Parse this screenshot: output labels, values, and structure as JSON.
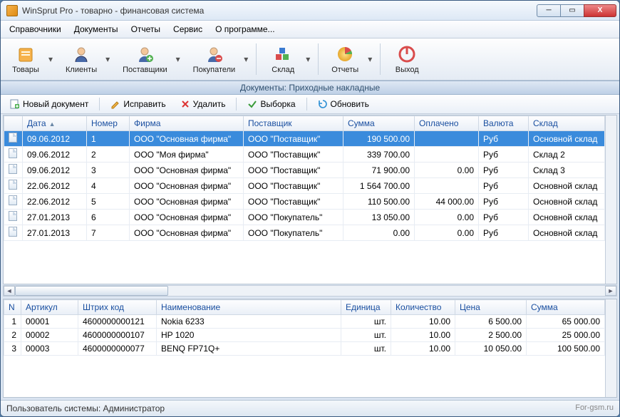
{
  "window": {
    "title": "WinSprut Pro - товарно - финансовая система"
  },
  "menu": [
    "Справочники",
    "Документы",
    "Отчеты",
    "Сервис",
    "О программе..."
  ],
  "toolbar": [
    {
      "label": "Товары",
      "icon": "goods"
    },
    {
      "label": "Клиенты",
      "icon": "clients"
    },
    {
      "label": "Поставщики",
      "icon": "suppliers"
    },
    {
      "label": "Покупатели",
      "icon": "buyers"
    },
    {
      "label": "Склад",
      "icon": "warehouse"
    },
    {
      "label": "Отчеты",
      "icon": "reports"
    },
    {
      "label": "Выход",
      "icon": "exit"
    }
  ],
  "panel_title": "Документы: Приходные накладные",
  "actions": {
    "new": "Новый документ",
    "edit": "Исправить",
    "delete": "Удалить",
    "filter": "Выборка",
    "refresh": "Обновить"
  },
  "docs": {
    "columns": [
      "Дата",
      "Номер",
      "Фирма",
      "Поставщик",
      "Сумма",
      "Оплачено",
      "Валюта",
      "Склад"
    ],
    "rows": [
      {
        "date": "09.06.2012",
        "num": "1",
        "firm": "ООО \"Основная фирма\"",
        "supplier": "ООО \"Поставщик\"",
        "sum": "190 500.00",
        "paid": "",
        "cur": "Руб",
        "store": "Основной склад",
        "selected": true
      },
      {
        "date": "09.06.2012",
        "num": "2",
        "firm": "ООО \"Моя фирма\"",
        "supplier": "ООО \"Поставщик\"",
        "sum": "339 700.00",
        "paid": "",
        "cur": "Руб",
        "store": "Склад 2"
      },
      {
        "date": "09.06.2012",
        "num": "3",
        "firm": "ООО \"Основная фирма\"",
        "supplier": "ООО \"Поставщик\"",
        "sum": "71 900.00",
        "paid": "0.00",
        "cur": "Руб",
        "store": "Склад 3"
      },
      {
        "date": "22.06.2012",
        "num": "4",
        "firm": "ООО \"Основная фирма\"",
        "supplier": "ООО \"Поставщик\"",
        "sum": "1 564 700.00",
        "paid": "",
        "cur": "Руб",
        "store": "Основной склад"
      },
      {
        "date": "22.06.2012",
        "num": "5",
        "firm": "ООО \"Основная фирма\"",
        "supplier": "ООО \"Поставщик\"",
        "sum": "110 500.00",
        "paid": "44 000.00",
        "cur": "Руб",
        "store": "Основной склад"
      },
      {
        "date": "27.01.2013",
        "num": "6",
        "firm": "ООО \"Основная фирма\"",
        "supplier": "ООО \"Покупатель\"",
        "sum": "13 050.00",
        "paid": "0.00",
        "cur": "Руб",
        "store": "Основной склад"
      },
      {
        "date": "27.01.2013",
        "num": "7",
        "firm": "ООО \"Основная фирма\"",
        "supplier": "ООО \"Покупатель\"",
        "sum": "0.00",
        "paid": "0.00",
        "cur": "Руб",
        "store": "Основной склад"
      }
    ]
  },
  "details": {
    "columns": [
      "N",
      "Артикул",
      "Штрих код",
      "Наименование",
      "Единица",
      "Количество",
      "Цена",
      "Сумма"
    ],
    "rows": [
      {
        "n": "1",
        "art": "00001",
        "bar": "4600000000121",
        "name": "Nokia 6233",
        "unit": "шт.",
        "qty": "10.00",
        "price": "6 500.00",
        "sum": "65 000.00"
      },
      {
        "n": "2",
        "art": "00002",
        "bar": "4600000000107",
        "name": "HP 1020",
        "unit": "шт.",
        "qty": "10.00",
        "price": "2 500.00",
        "sum": "25 000.00"
      },
      {
        "n": "3",
        "art": "00003",
        "bar": "4600000000077",
        "name": "BENQ FP71Q+",
        "unit": "шт.",
        "qty": "10.00",
        "price": "10 050.00",
        "sum": "100 500.00"
      }
    ]
  },
  "status": {
    "user_label": "Пользователь системы: Администратор",
    "watermark": "For-gsm.ru"
  }
}
